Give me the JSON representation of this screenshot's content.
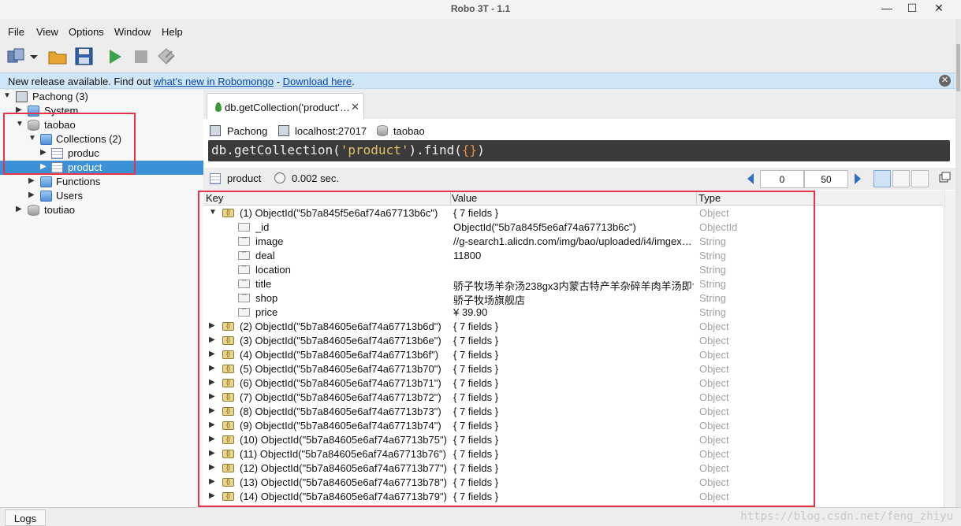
{
  "window": {
    "title": "Robo 3T - 1.1",
    "minimize": "—",
    "maximize": "☐",
    "close": "✕"
  },
  "menu": [
    "File",
    "View",
    "Options",
    "Window",
    "Help"
  ],
  "notice": {
    "prefix": "New release available. Find out ",
    "link1": "what's new in Robomongo",
    "sep": " - ",
    "link2": "Download here",
    "suffix": "."
  },
  "tree": {
    "server": "Pachong (3)",
    "system": "System",
    "db": "taobao",
    "collections": "Collections (2)",
    "coll1": "produc",
    "coll2": "product",
    "functions": "Functions",
    "users": "Users",
    "db2": "toutiao"
  },
  "tab": {
    "title": "db.getCollection('product'…",
    "close": "✕"
  },
  "crumbs": {
    "server": "Pachong",
    "host": "localhost:27017",
    "db": "taobao"
  },
  "query": {
    "prefix": "db.getCollection(",
    "arg": "'product'",
    "mid": ").find(",
    "b1": "{",
    "b2": "}",
    "end": ")"
  },
  "result": {
    "collection": "product",
    "time": "0.002 sec.",
    "skip": "0",
    "limit": "50"
  },
  "grid": {
    "headers": {
      "key": "Key",
      "value": "Value",
      "type": "Type"
    },
    "rows": [
      {
        "key": "(1) ObjectId(\"5b7a845f5e6af74a67713b6c\")",
        "value": "{ 7 fields }",
        "type": "Object"
      },
      {
        "key": "_id",
        "value": "ObjectId(\"5b7a845f5e6af74a67713b6c\")",
        "type": "ObjectId"
      },
      {
        "key": "image",
        "value": "//g-search1.alicdn.com/img/bao/uploaded/i4/imgex…",
        "type": "String"
      },
      {
        "key": "deal",
        "value": "11800",
        "type": "String"
      },
      {
        "key": "location",
        "value": "",
        "type": "String"
      },
      {
        "key": "title",
        "value": "骄子牧场羊杂汤238gx3内蒙古特产羊杂碎羊肉羊汤即食…",
        "type": "String"
      },
      {
        "key": "shop",
        "value": "骄子牧场旗舰店",
        "type": "String"
      },
      {
        "key": "price",
        "value": "¥ 39.90",
        "type": "String"
      },
      {
        "key": "(2) ObjectId(\"5b7a84605e6af74a67713b6d\")",
        "value": "{ 7 fields }",
        "type": "Object"
      },
      {
        "key": "(3) ObjectId(\"5b7a84605e6af74a67713b6e\")",
        "value": "{ 7 fields }",
        "type": "Object"
      },
      {
        "key": "(4) ObjectId(\"5b7a84605e6af74a67713b6f\")",
        "value": "{ 7 fields }",
        "type": "Object"
      },
      {
        "key": "(5) ObjectId(\"5b7a84605e6af74a67713b70\")",
        "value": "{ 7 fields }",
        "type": "Object"
      },
      {
        "key": "(6) ObjectId(\"5b7a84605e6af74a67713b71\")",
        "value": "{ 7 fields }",
        "type": "Object"
      },
      {
        "key": "(7) ObjectId(\"5b7a84605e6af74a67713b72\")",
        "value": "{ 7 fields }",
        "type": "Object"
      },
      {
        "key": "(8) ObjectId(\"5b7a84605e6af74a67713b73\")",
        "value": "{ 7 fields }",
        "type": "Object"
      },
      {
        "key": "(9) ObjectId(\"5b7a84605e6af74a67713b74\")",
        "value": "{ 7 fields }",
        "type": "Object"
      },
      {
        "key": "(10) ObjectId(\"5b7a84605e6af74a67713b75\")",
        "value": "{ 7 fields }",
        "type": "Object"
      },
      {
        "key": "(11) ObjectId(\"5b7a84605e6af74a67713b76\")",
        "value": "{ 7 fields }",
        "type": "Object"
      },
      {
        "key": "(12) ObjectId(\"5b7a84605e6af74a67713b77\")",
        "value": "{ 7 fields }",
        "type": "Object"
      },
      {
        "key": "(13) ObjectId(\"5b7a84605e6af74a67713b78\")",
        "value": "{ 7 fields }",
        "type": "Object"
      },
      {
        "key": "(14) ObjectId(\"5b7a84605e6af74a67713b79\")",
        "value": "{ 7 fields }",
        "type": "Object"
      }
    ]
  },
  "status": {
    "logs": "Logs",
    "watermark": "https://blog.csdn.net/feng_zhiyu"
  },
  "colors": {
    "accent": "#3c90d6",
    "highlight": "#e8334a",
    "notice_bg": "#cfe6f8"
  }
}
